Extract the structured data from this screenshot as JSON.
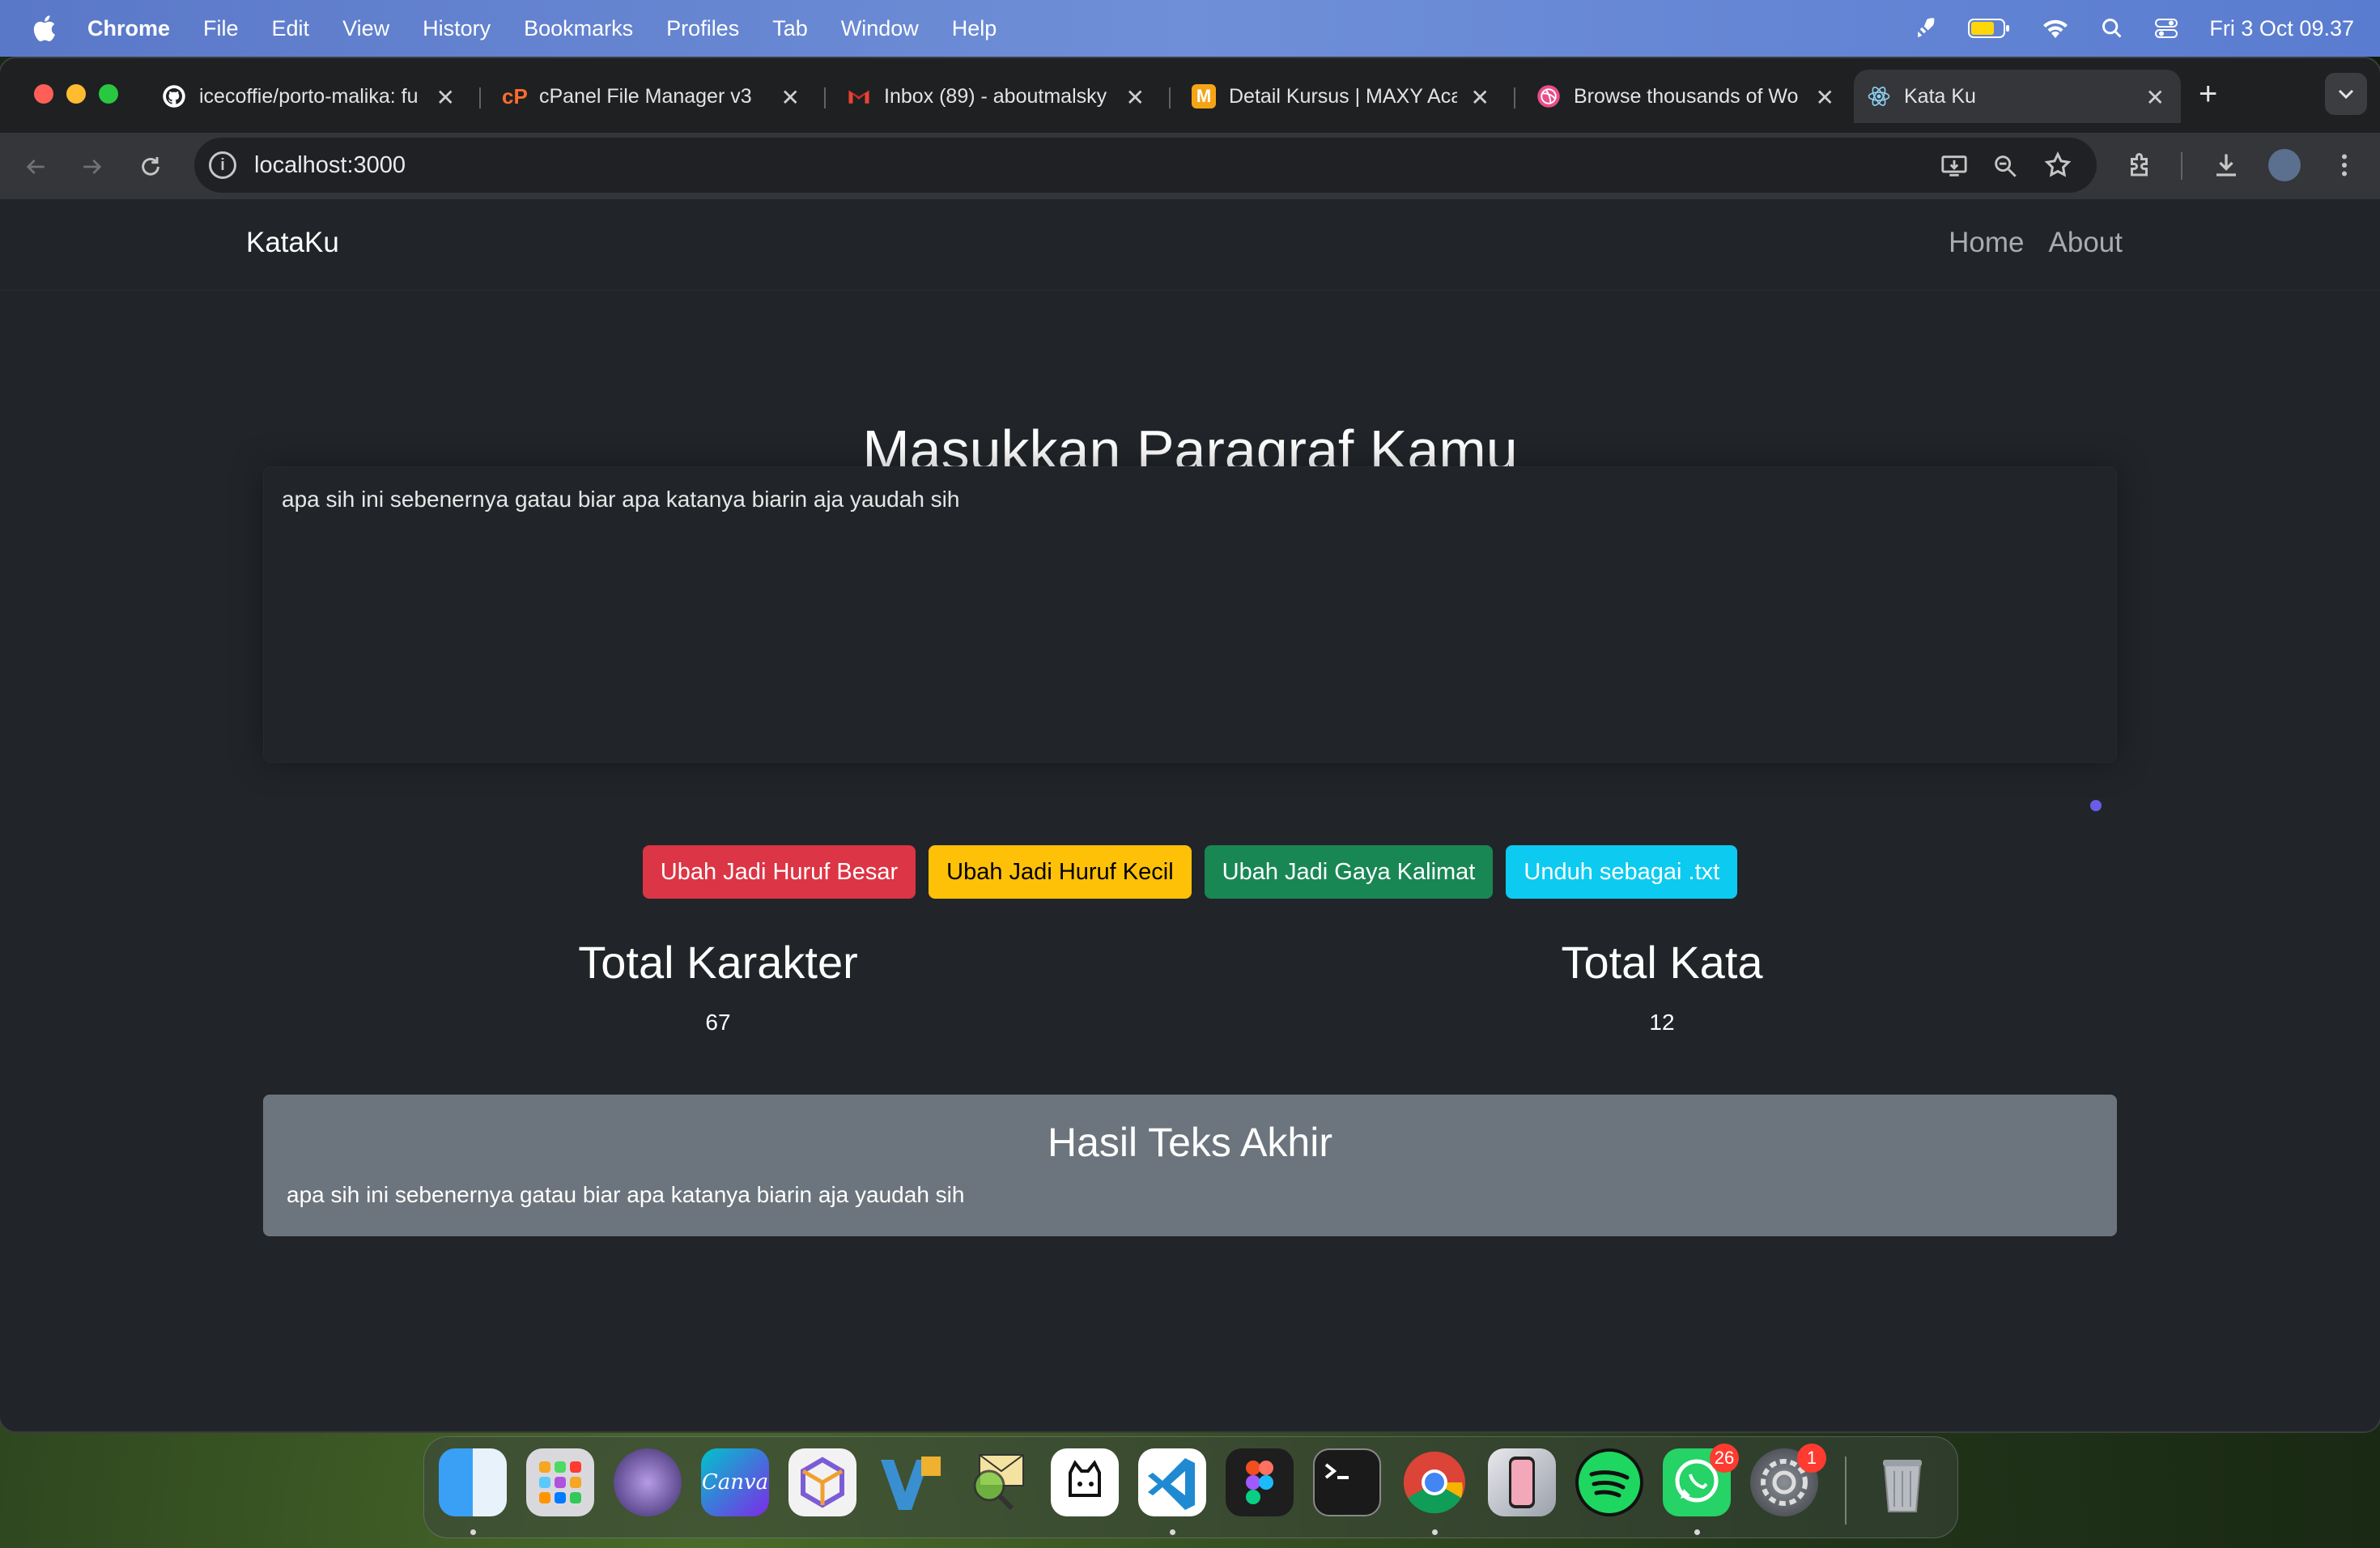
{
  "menubar": {
    "app_name": "Chrome",
    "menus": [
      "File",
      "Edit",
      "View",
      "History",
      "Bookmarks",
      "Profiles",
      "Tab",
      "Window",
      "Help"
    ],
    "datetime": "Fri 3 Oct  09.37"
  },
  "browser": {
    "tabs": [
      {
        "title": "icecoffie/porto-malika: fu",
        "favicon": "github-icon"
      },
      {
        "title": "cPanel File Manager v3",
        "favicon": "cpanel-icon"
      },
      {
        "title": "Inbox (89) - aboutmalsky",
        "favicon": "gmail-icon"
      },
      {
        "title": "Detail Kursus | MAXY Aca",
        "favicon": "maxy-icon"
      },
      {
        "title": "Browse thousands of Wo",
        "favicon": "dribbble-icon"
      },
      {
        "title": "Kata Ku",
        "favicon": "react-icon",
        "active": true
      }
    ],
    "url": "localhost:3000"
  },
  "app": {
    "brand": "KataKu",
    "nav": {
      "home": "Home",
      "about": "About"
    },
    "heading": "Masukkan Paragraf Kamu",
    "textarea_value": "apa sih ini sebenernya gatau biar apa katanya biarin aja yaudah sih",
    "buttons": {
      "uppercase": "Ubah Jadi Huruf Besar",
      "lowercase": "Ubah Jadi Huruf Kecil",
      "sentence": "Ubah Jadi Gaya Kalimat",
      "download": "Unduh sebagai .txt"
    },
    "stats": {
      "char_label": "Total Karakter",
      "char_value": "67",
      "word_label": "Total Kata",
      "word_value": "12"
    },
    "result": {
      "title": "Hasil Teks Akhir",
      "text": "apa sih ini sebenernya gatau biar apa katanya biarin aja yaudah sih"
    }
  },
  "dock": {
    "apps": [
      "Finder",
      "Launchpad",
      "Cat App",
      "Canva",
      "Cube",
      "Vectornator",
      "Mail Search",
      "Notion Cat",
      "VS Code",
      "Figma",
      "Terminal",
      "Chrome",
      "iPhone Mirroring",
      "Spotify",
      "WhatsApp",
      "System Settings"
    ],
    "badges": {
      "whatsapp": "26",
      "settings": "1"
    }
  }
}
